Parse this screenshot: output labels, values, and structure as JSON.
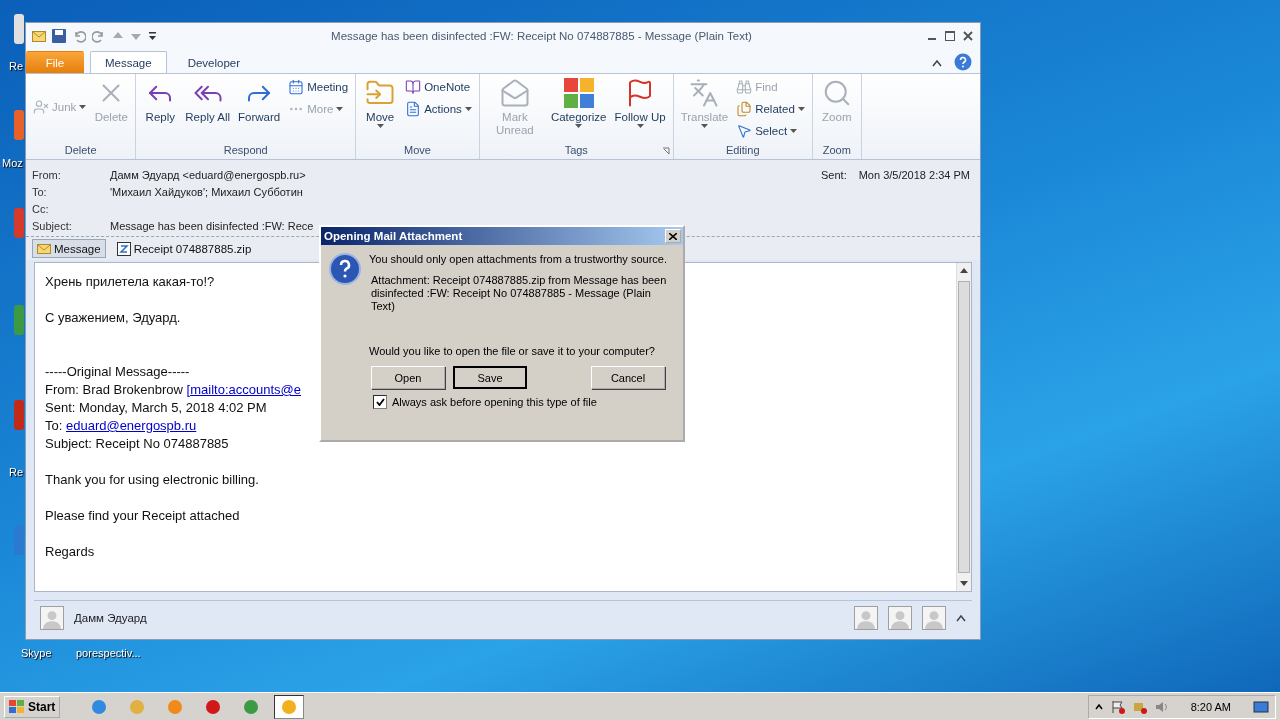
{
  "desktop": {
    "icons": [
      {
        "label": "Re"
      },
      {
        "label": "Moz"
      },
      {
        "label": "Re"
      }
    ],
    "bottom_icons": [
      {
        "label": "Skype"
      },
      {
        "label": "porespectiv..."
      }
    ]
  },
  "window": {
    "title": "Message has been disinfected :FW: Receipt No 074887885  -  Message (Plain Text)",
    "tabs": [
      {
        "label": "File",
        "kind": "file",
        "selected": false
      },
      {
        "label": "Message",
        "kind": "tab",
        "selected": true
      },
      {
        "label": "Developer",
        "kind": "tab",
        "selected": false
      }
    ],
    "ribbon_groups": [
      {
        "label": "Delete",
        "launcher": false,
        "items": [
          {
            "kind": "stack",
            "items": [
              {
                "label": "Junk",
                "disabled": true,
                "dropdown": true
              }
            ]
          },
          {
            "kind": "large",
            "label": "Delete",
            "disabled": true,
            "dropdown": false
          }
        ]
      },
      {
        "label": "Respond",
        "launcher": false,
        "items": [
          {
            "kind": "large",
            "label": "Reply",
            "disabled": false,
            "dropdown": false
          },
          {
            "kind": "large",
            "label": "Reply All",
            "disabled": false,
            "dropdown": false
          },
          {
            "kind": "large",
            "label": "Forward",
            "disabled": false,
            "dropdown": false
          },
          {
            "kind": "stack",
            "items": [
              {
                "label": "Meeting",
                "disabled": false,
                "dropdown": false
              },
              {
                "label": "More",
                "disabled": true,
                "dropdown": true
              }
            ]
          }
        ]
      },
      {
        "label": "Move",
        "launcher": false,
        "items": [
          {
            "kind": "large",
            "label": "Move",
            "disabled": false,
            "dropdown": true
          },
          {
            "kind": "stack",
            "items": [
              {
                "label": "OneNote",
                "disabled": false,
                "dropdown": false
              },
              {
                "label": "Actions",
                "disabled": false,
                "dropdown": true
              }
            ]
          }
        ]
      },
      {
        "label": "Tags",
        "launcher": true,
        "items": [
          {
            "kind": "large",
            "label": "Mark Unread",
            "disabled": true,
            "dropdown": false
          },
          {
            "kind": "large",
            "label": "Categorize",
            "disabled": false,
            "dropdown": true
          },
          {
            "kind": "large",
            "label": "Follow Up",
            "disabled": false,
            "dropdown": true
          }
        ]
      },
      {
        "label": "Editing",
        "launcher": false,
        "items": [
          {
            "kind": "large",
            "label": "Translate",
            "disabled": true,
            "dropdown": true
          },
          {
            "kind": "stack",
            "items": [
              {
                "label": "Find",
                "disabled": true,
                "dropdown": false
              },
              {
                "label": "Related",
                "disabled": false,
                "dropdown": true
              },
              {
                "label": "Select",
                "disabled": false,
                "dropdown": true
              }
            ]
          }
        ]
      },
      {
        "label": "Zoom",
        "launcher": false,
        "items": [
          {
            "kind": "large",
            "label": "Zoom",
            "disabled": true,
            "dropdown": false
          }
        ]
      }
    ],
    "header": {
      "fields": [
        {
          "label": "From:",
          "value": "Дамм Эдуард <eduard@energospb.ru>"
        },
        {
          "label": "To:",
          "value": "'Михаил Хайдуков'; Михаил Субботин"
        },
        {
          "label": "Cc:"
        },
        {
          "label": "Subject:",
          "value": "Message has been disinfected :FW: Rece"
        }
      ],
      "sent_label": "Sent:",
      "sent_value": "Mon 3/5/2018 2:34 PM"
    },
    "attachments": [
      {
        "label": "Message",
        "kind": "message",
        "selected": true
      },
      {
        "label": "Receipt 074887885.zip",
        "kind": "zip",
        "selected": false
      }
    ],
    "body": [
      {
        "kind": "text",
        "lines": [
          {
            "text": "Хрень прилетела какая-то!?"
          }
        ]
      },
      {
        "kind": "text",
        "lines": [
          {
            "text": "С уважением, Эдуард."
          }
        ]
      },
      {
        "kind": "quote",
        "lines": [
          {
            "text": "-----Original Message-----"
          },
          {
            "text": "From: Brad Brokenbrow ",
            "link": "[mailto:accounts@e"
          },
          {
            "text": "Sent: Monday, March 5, 2018 4:02 PM"
          },
          {
            "text": "To: ",
            "link": "eduard@energospb.ru"
          },
          {
            "text": "Subject: Receipt No 074887885"
          }
        ]
      },
      {
        "kind": "text",
        "lines": [
          {
            "text": "Thank you for using electronic billing."
          }
        ]
      },
      {
        "kind": "text",
        "lines": [
          {
            "text": "Please find your Receipt attached"
          }
        ]
      },
      {
        "kind": "text",
        "lines": [
          {
            "text": "Regards"
          }
        ]
      }
    ],
    "people": {
      "name": "Дамм Эдуард"
    }
  },
  "dialog": {
    "title": "Opening Mail Attachment",
    "warning": "You should only open attachments from a trustworthy source.",
    "detail": "Attachment: Receipt 074887885.zip from Message has been disinfected :FW: Receipt No 074887885 - Message (Plain Text)",
    "question": "Would you like to open the file or save it to your computer?",
    "buttons": [
      {
        "label": "Open",
        "default": false
      },
      {
        "label": "Save",
        "default": true
      },
      {
        "label": "Cancel",
        "default": false
      }
    ],
    "checkbox": {
      "label": "Always ask before opening this type of file",
      "checked": true
    }
  },
  "taskbar": {
    "start": "Start",
    "apps": [
      {
        "selected": false
      },
      {
        "selected": false
      },
      {
        "selected": false
      },
      {
        "selected": false
      },
      {
        "selected": false
      },
      {
        "selected": true
      }
    ],
    "clock": "8:20 AM"
  }
}
